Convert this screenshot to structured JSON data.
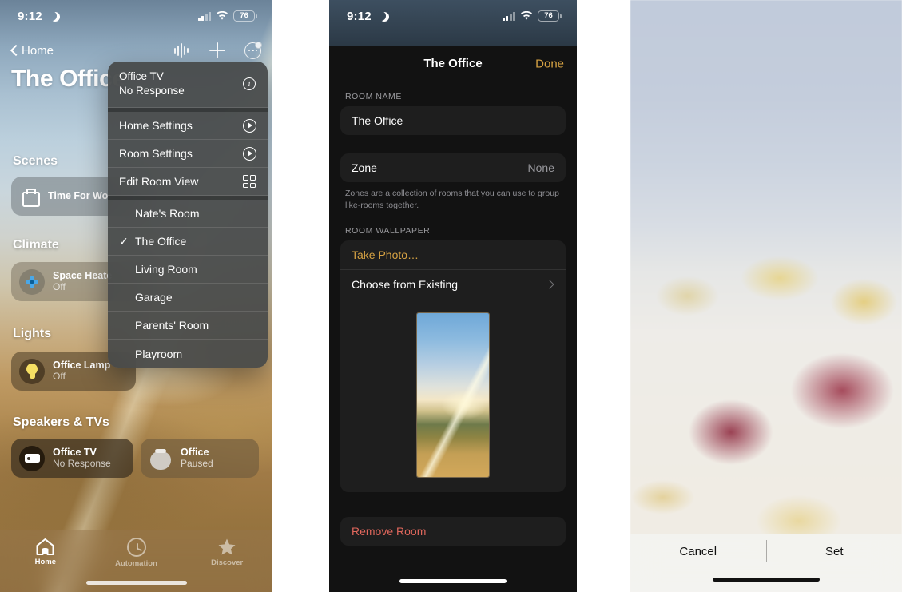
{
  "status_bar": {
    "time": "9:12",
    "moon_icon": "moon-crescent-icon",
    "battery": "76",
    "wifi_icon": "wifi-icon",
    "cellular_icon": "cellular-signal-icon"
  },
  "panel1": {
    "nav": {
      "back_label": "Home",
      "back_icon": "chevron-left-icon",
      "waveform_icon": "audio-waveform-icon",
      "add_icon": "plus-icon",
      "more_icon": "more-ellipsis-circle-icon"
    },
    "room_title": "The Office",
    "sections": [
      {
        "title": "Scenes"
      },
      {
        "title": "Climate"
      },
      {
        "title": "Lights"
      },
      {
        "title": "Speakers & TVs"
      }
    ],
    "tiles": {
      "scene": {
        "name": "Time For Wo",
        "sub": "",
        "icon": "briefcase-icon"
      },
      "climate": {
        "name": "Space Heate",
        "sub": "Off",
        "icon": "fan-icon"
      },
      "light": {
        "name": "Office Lamp",
        "sub": "Off",
        "icon": "lightbulb-icon"
      },
      "tv": {
        "name": "Office TV",
        "sub": "No Response",
        "icon": "appletv-icon"
      },
      "speaker": {
        "name": "Office",
        "sub": "Paused",
        "icon": "homepod-icon"
      }
    },
    "context_menu": {
      "header": {
        "line1": "Office TV",
        "line2": "No Response",
        "icon": "info-circle-icon"
      },
      "actions": [
        {
          "label": "Home Settings",
          "icon": "settings-play-icon"
        },
        {
          "label": "Room Settings",
          "icon": "settings-play-icon"
        },
        {
          "label": "Edit Room View",
          "icon": "grid-layout-icon"
        }
      ],
      "rooms": [
        {
          "label": "Nate's Room",
          "checked": false
        },
        {
          "label": "The Office",
          "checked": true
        },
        {
          "label": "Living Room",
          "checked": false
        },
        {
          "label": "Garage",
          "checked": false
        },
        {
          "label": "Parents' Room",
          "checked": false
        },
        {
          "label": "Playroom",
          "checked": false
        }
      ],
      "check_glyph": "✓"
    },
    "tabs": [
      {
        "label": "Home",
        "icon": "home-icon",
        "active": true
      },
      {
        "label": "Automation",
        "icon": "automation-icon",
        "active": false
      },
      {
        "label": "Discover",
        "icon": "star-icon",
        "active": false
      }
    ]
  },
  "panel2": {
    "sheet_title": "The Office",
    "done_label": "Done",
    "done_color": "#d6a243",
    "room_name_label": "ROOM NAME",
    "room_name_value": "The Office",
    "zone_label": "Zone",
    "zone_value": "None",
    "zone_note": "Zones are a collection of rooms that you can use to group like-rooms together.",
    "wallpaper_label": "ROOM WALLPAPER",
    "take_photo_label": "Take Photo…",
    "choose_existing_label": "Choose from Existing",
    "choose_existing_icon": "chevron-right-icon",
    "wallpaper_thumb_name": "wallpaper-preview-thumbnail",
    "remove_room_label": "Remove Room",
    "remove_color": "#e0675c"
  },
  "panel3": {
    "cancel_label": "Cancel",
    "set_label": "Set",
    "image_name": "flower-field-wallpaper-preview"
  }
}
